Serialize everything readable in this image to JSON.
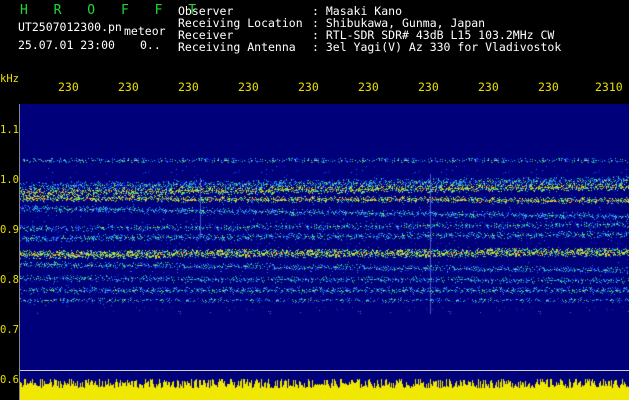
{
  "header": {
    "brand": "H R O F F T",
    "file_name": "UT2507012300.pn",
    "mode": "meteor",
    "datetime": "25.07.01 23:00",
    "duration": "0..",
    "fields": [
      {
        "label": "Observer",
        "value": ": Masaki Kano"
      },
      {
        "label": "Receiving Location",
        "value": ": Shibukawa, Gunma, Japan"
      },
      {
        "label": "Receiver",
        "value": ": RTL-SDR SDR# 43dB L15 103.2MHz CW"
      },
      {
        "label": "Receiving Antenna",
        "value": ": 3el Yagi(V) Az 330 for Vladivostok"
      }
    ]
  },
  "axes": {
    "y_unit": "kHz",
    "time_ticks": [
      "230",
      "230",
      "230",
      "230",
      "230",
      "230",
      "230",
      "230",
      "230",
      "2310"
    ],
    "freq_labels": [
      "1.1",
      "1.0",
      "0.9",
      "0.8",
      "0.7",
      "0.6"
    ]
  },
  "colors": {
    "text": "#ffffff",
    "brand": "#22d63a",
    "axis": "#e8e000",
    "background": "#00007a",
    "signal_peak": "#ff3a1a",
    "noise_floor": "#f0e800"
  }
}
